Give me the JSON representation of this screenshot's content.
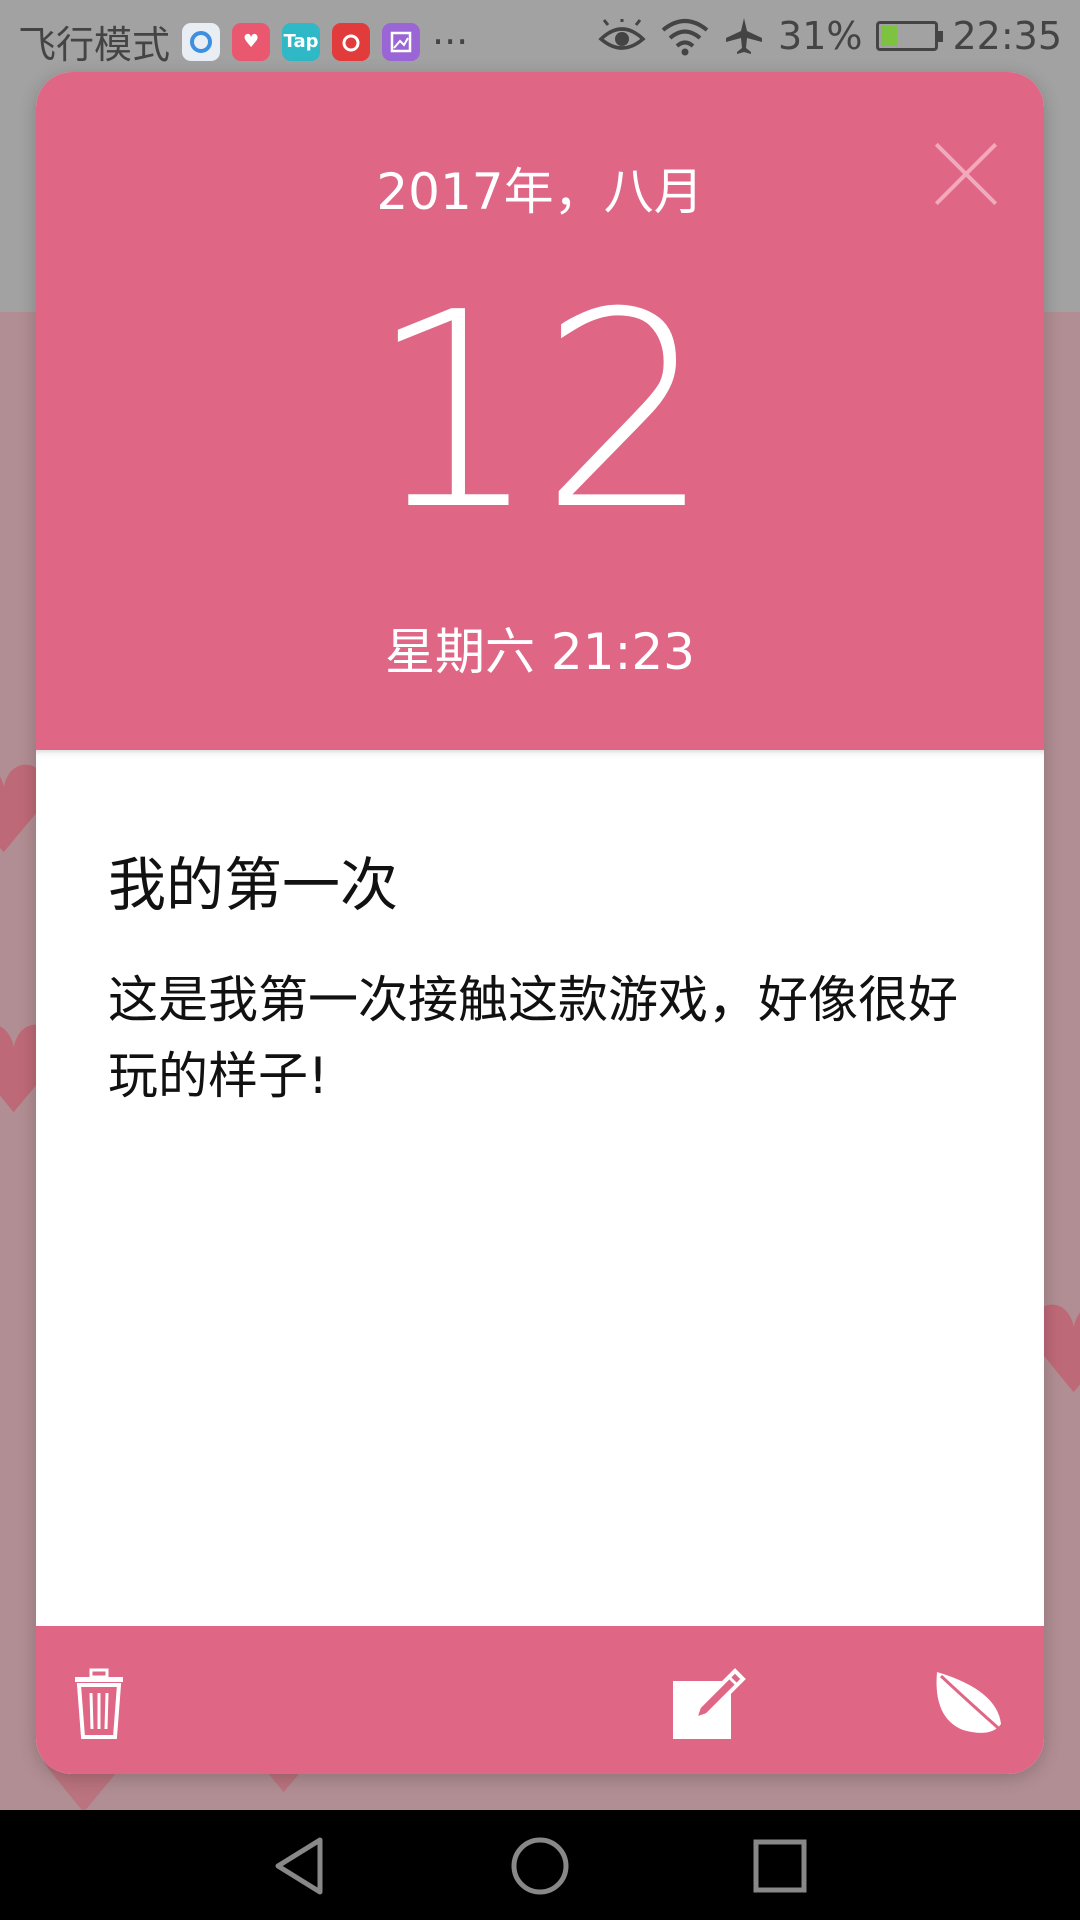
{
  "status_bar": {
    "mode_text": "飞行模式",
    "apps": [
      {
        "icon": "browser-app-icon",
        "color": "#e9eef5",
        "glyph": ""
      },
      {
        "icon": "health-app-icon",
        "color": "#e9586e",
        "glyph": "♥"
      },
      {
        "icon": "taptap-app-icon",
        "color": "#2fb8c5",
        "glyph": "Tap"
      },
      {
        "icon": "netease-music-app-icon",
        "color": "#e23b3b",
        "glyph": "♪"
      },
      {
        "icon": "gallery-app-icon",
        "color": "#9a66d6",
        "glyph": "▨"
      }
    ],
    "more": "···",
    "battery_percent": "31%",
    "battery_level": 0.31,
    "time": "22:35"
  },
  "colors": {
    "accent": "#e06686",
    "close": "#f2a9bb"
  },
  "card": {
    "year_month": "2017年，八月",
    "day": "12",
    "weekday_time": "星期六 21:23",
    "note_title": "我的第一次",
    "note_content": "这是我第一次接触这款游戏，好像很好玩的样子!"
  },
  "footer_icons": [
    "trash-icon",
    "edit-icon",
    "leaf-icon"
  ],
  "nav_icons": [
    "back-icon",
    "home-icon",
    "recents-icon"
  ]
}
